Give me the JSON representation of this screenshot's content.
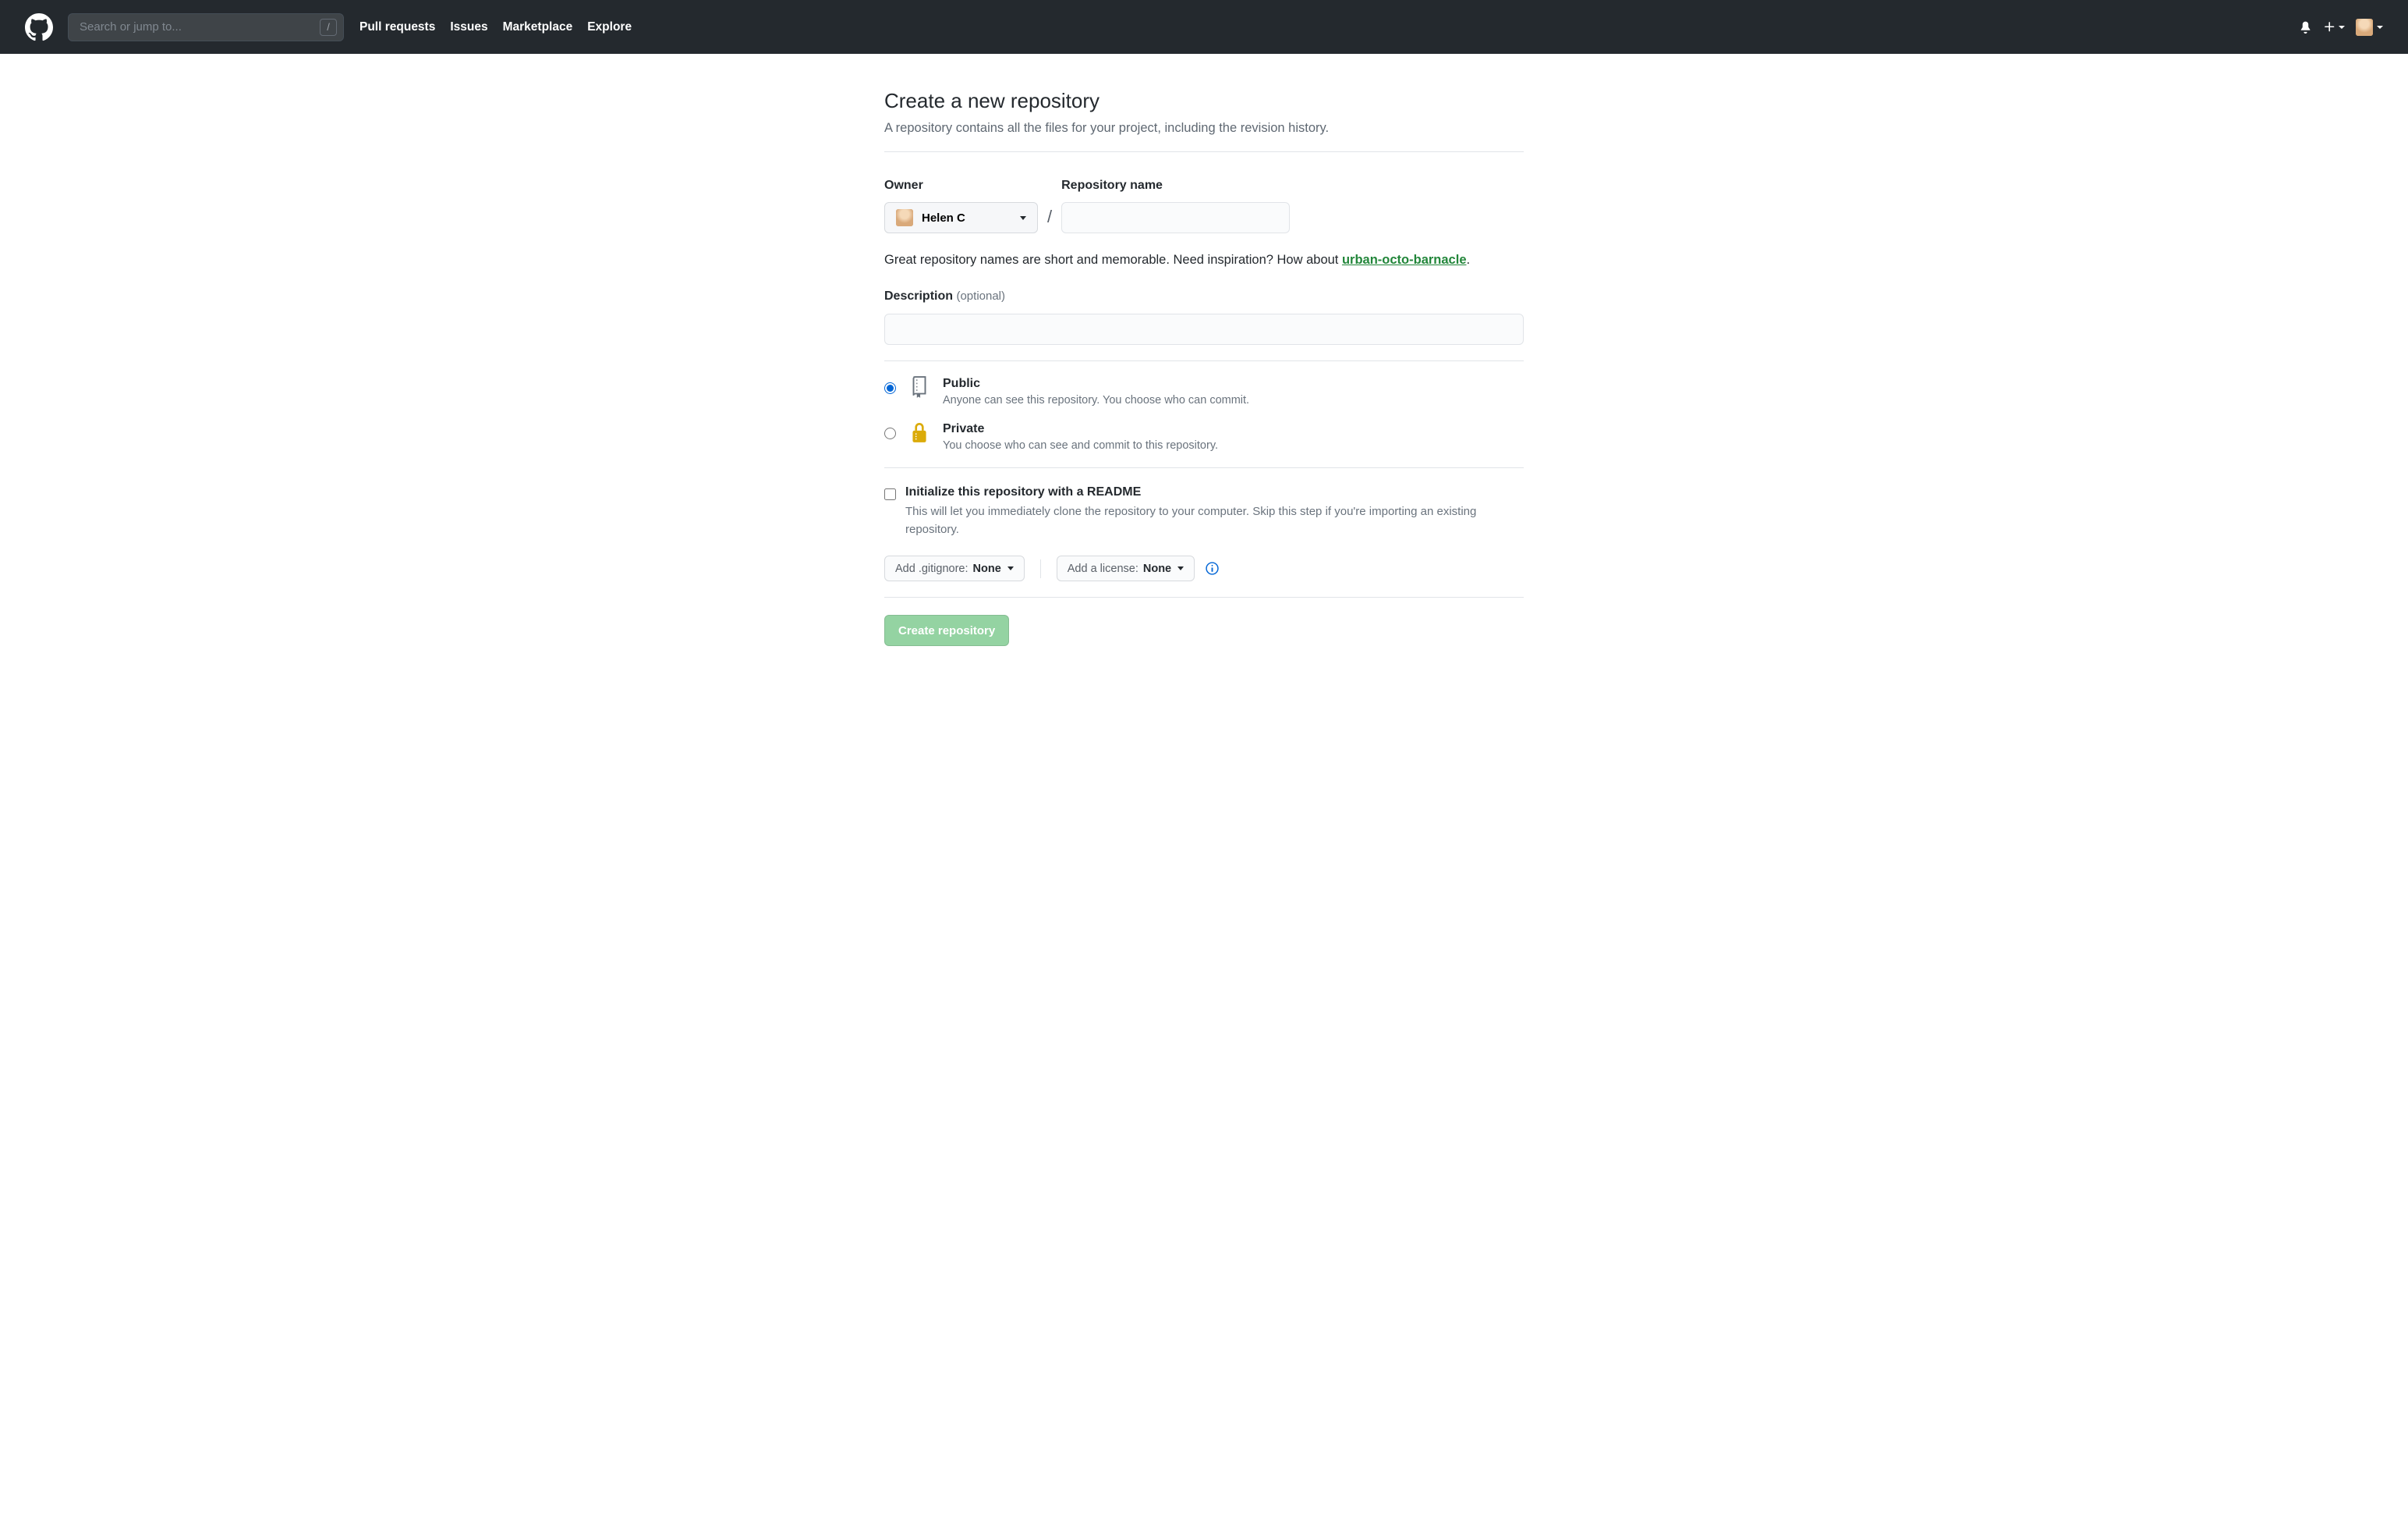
{
  "header": {
    "search_placeholder": "Search or jump to...",
    "slash": "/",
    "nav": [
      "Pull requests",
      "Issues",
      "Marketplace",
      "Explore"
    ]
  },
  "page": {
    "title": "Create a new repository",
    "subtitle": "A repository contains all the files for your project, including the revision history."
  },
  "form": {
    "owner_label": "Owner",
    "owner_value": "Helen C",
    "repo_label": "Repository name",
    "repo_value": "",
    "slash": "/",
    "hint_prefix": "Great repository names are short and memorable. Need inspiration? How about ",
    "hint_suggestion": "urban-octo-barnacle",
    "hint_suffix": ".",
    "desc_label": "Description",
    "desc_optional": "(optional)",
    "desc_value": ""
  },
  "visibility": {
    "public_label": "Public",
    "public_desc": "Anyone can see this repository. You choose who can commit.",
    "private_label": "Private",
    "private_desc": "You choose who can see and commit to this repository."
  },
  "readme": {
    "label": "Initialize this repository with a README",
    "desc": "This will let you immediately clone the repository to your computer. Skip this step if you're importing an existing repository."
  },
  "dropdowns": {
    "gitignore_label": "Add .gitignore: ",
    "gitignore_value": "None",
    "license_label": "Add a license: ",
    "license_value": "None"
  },
  "submit": "Create repository"
}
